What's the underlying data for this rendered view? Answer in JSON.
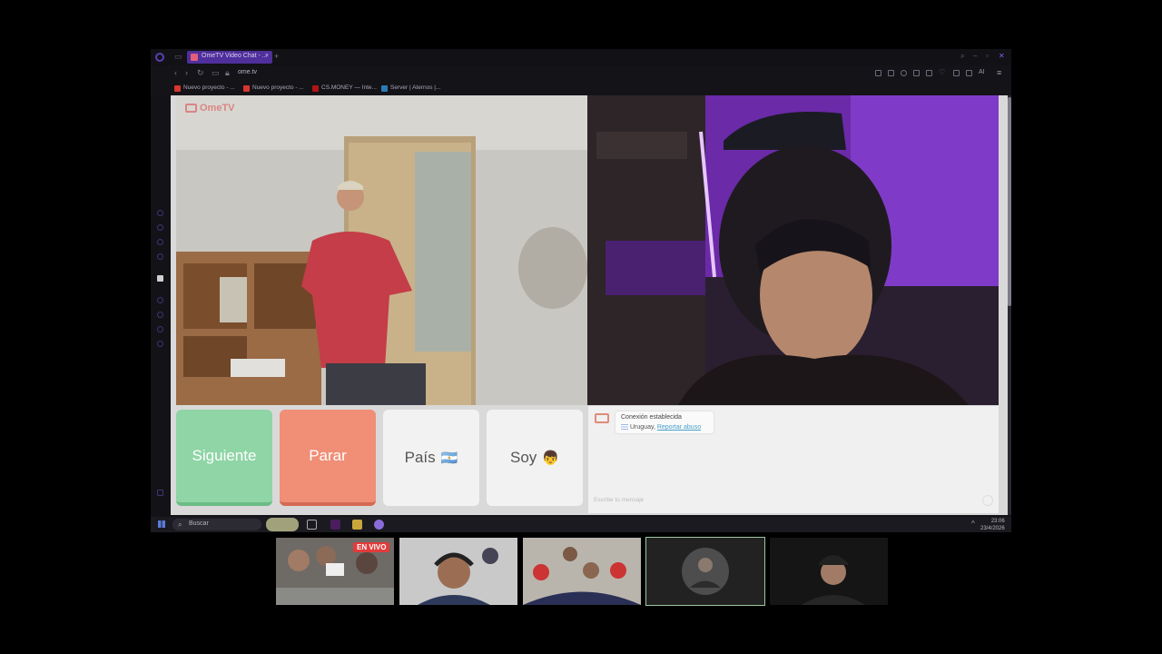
{
  "browser": {
    "tab_title": "OmeTV Video Chat - ...",
    "url": "ome.tv",
    "ai_label": "AI",
    "bookmarks": [
      {
        "label": "Nuevo proyecto - ...",
        "color": "#d8362f"
      },
      {
        "label": "Nuevo proyecto - ...",
        "color": "#d8362f"
      },
      {
        "label": "CS.MONEY — Inte...",
        "color": "#b01515"
      },
      {
        "label": "Server | Aternos |...",
        "color": "#2a7ab8"
      }
    ]
  },
  "ometv": {
    "logo_text": "OmeTV",
    "buttons": {
      "next": "Siguiente",
      "stop": "Parar",
      "country": "País",
      "country_flag": "🇦🇷",
      "soy": "Soy",
      "soy_emoji": "👦"
    },
    "chat": {
      "status": "Conexión establecida",
      "country": "Uruguay,",
      "report_link": "Reportar abuso",
      "placeholder": "Escribe tu mensaje"
    }
  },
  "taskbar": {
    "search_placeholder": "Buscar",
    "time": "23:06",
    "date": "23/4/2026"
  },
  "stream": {
    "live_badge": "EN VIVO"
  },
  "colors": {
    "accent": "#4f2f9c",
    "next_button": "#8fd5a6",
    "stop_button": "#f08e76"
  }
}
